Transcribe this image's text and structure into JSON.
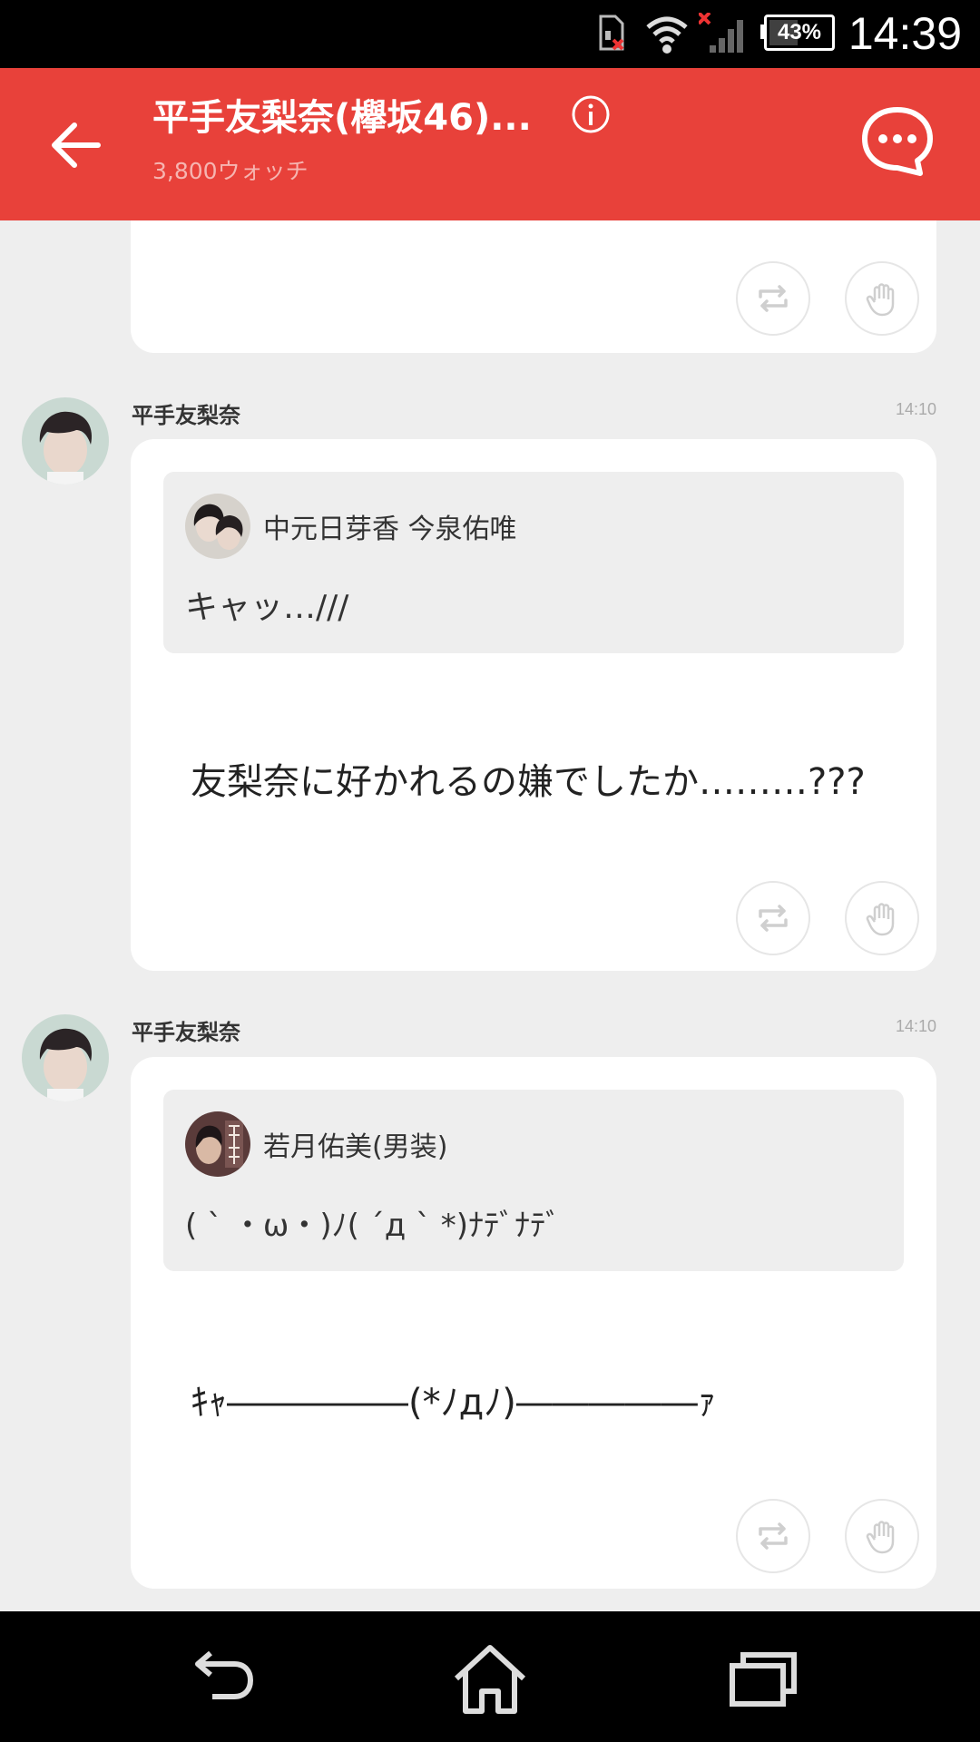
{
  "status_bar": {
    "battery": "43%",
    "battery_level": 0.43,
    "time": "14:39",
    "icons": [
      "sim-error-icon",
      "wifi-icon",
      "cellular-signal-icon",
      "battery-icon"
    ]
  },
  "header": {
    "title": "平手友梨奈(欅坂46)...",
    "subtitle": "3,800ウォッチ",
    "back_icon": "arrow-left-icon",
    "info_icon": "info-icon",
    "chat_icon": "chat-bubble-icon",
    "accent": "#e8413a"
  },
  "messages": [
    {
      "sender": "平手友梨奈",
      "time": "14:10",
      "quote": {
        "author": "中元日芽香 今泉佑唯",
        "text": "キャッ…///"
      },
      "text": "友梨奈に好かれるの嫌でしたか………???"
    },
    {
      "sender": "平手友梨奈",
      "time": "14:10",
      "quote": {
        "author": "若月佑美(男装)",
        "text": "( ` ・ω・)ﾉ( ´д ` *)ﾅﾃﾞﾅﾃﾞ"
      },
      "text": "ｷｬ―――――(*ﾉдﾉ)―――――ｧ"
    }
  ],
  "actions": {
    "repost_icon": "repost-icon",
    "like_icon": "hand-icon"
  },
  "nav_bar": {
    "icons": [
      "back-nav-icon",
      "home-nav-icon",
      "recents-nav-icon"
    ]
  }
}
